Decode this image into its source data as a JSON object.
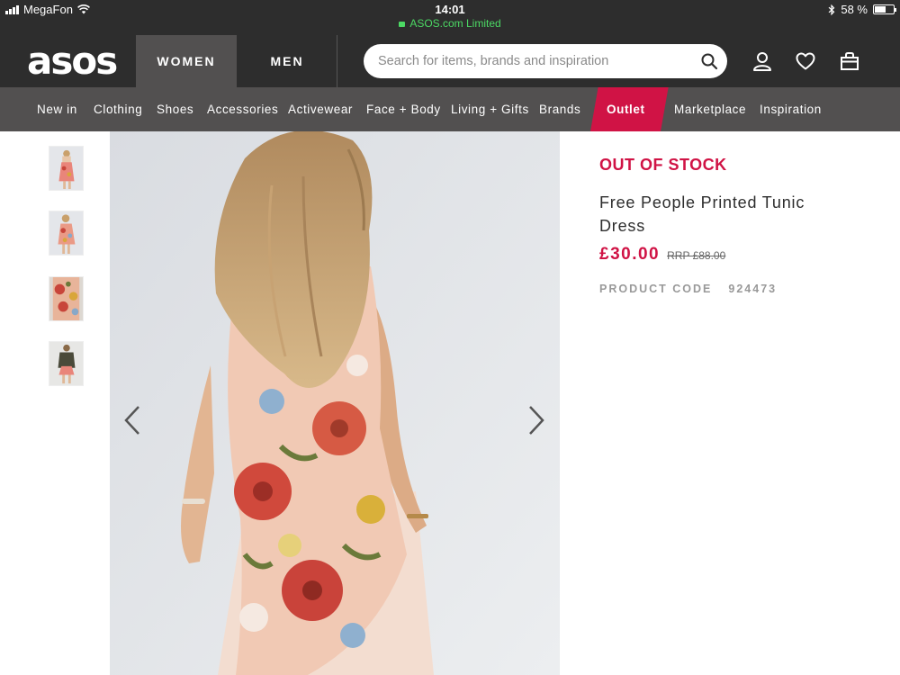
{
  "status_bar": {
    "carrier": "MegaFon",
    "time": "14:01",
    "url": "ASOS.com Limited",
    "battery": "58 %",
    "battery_level": 0.58
  },
  "header": {
    "logo": "asos",
    "tabs": [
      {
        "label": "WOMEN",
        "active": true
      },
      {
        "label": "MEN",
        "active": false
      }
    ],
    "search": {
      "placeholder": "Search for items, brands and inspiration",
      "value": ""
    },
    "icons": [
      "search-icon",
      "account-icon",
      "heart-icon",
      "bag-icon"
    ]
  },
  "nav": {
    "items": [
      {
        "label": "New in"
      },
      {
        "label": "Clothing"
      },
      {
        "label": "Shoes"
      },
      {
        "label": "Accessories"
      },
      {
        "label": "Activewear"
      },
      {
        "label": "Face + Body"
      },
      {
        "label": "Living + Gifts"
      },
      {
        "label": "Brands"
      },
      {
        "label": "Outlet",
        "highlight": true
      },
      {
        "label": "Marketplace"
      },
      {
        "label": "Inspiration"
      }
    ]
  },
  "gallery": {
    "thumbnail_count": 4,
    "icons": [
      "chevron-left-icon",
      "chevron-right-icon"
    ]
  },
  "product": {
    "stock_status": "OUT OF STOCK",
    "title": "Free People Printed Tunic Dress",
    "price": "£30.00",
    "rrp": "RRP £88.00",
    "code_label": "PRODUCT CODE",
    "code": "924473"
  },
  "colors": {
    "header_bg": "#2d2d2d",
    "nav_bg": "#525050",
    "accent": "#d01345",
    "secure_green": "#4cd964"
  }
}
